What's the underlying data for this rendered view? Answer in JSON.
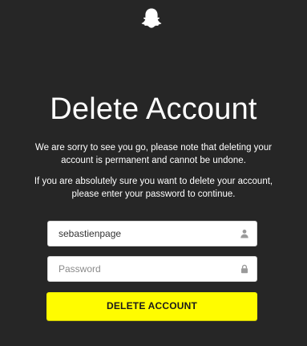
{
  "header": {
    "logo_icon": "snapchat-ghost-icon"
  },
  "page": {
    "title": "Delete Account",
    "message1_line1": "We are sorry to see you go, please note that deleting your",
    "message1_line2": "account is permanent and cannot be undone.",
    "message2_line1": "If you are absolutely sure you want to delete your account,",
    "message2_line2": "please enter your password to continue."
  },
  "form": {
    "username": {
      "value": "sebastienpage",
      "icon": "user-icon"
    },
    "password": {
      "value": "",
      "placeholder": "Password",
      "icon": "lock-icon"
    },
    "submit_label": "DELETE ACCOUNT"
  },
  "colors": {
    "background": "#262626",
    "accent": "#FFFC00",
    "text": "#FFFFFF"
  }
}
